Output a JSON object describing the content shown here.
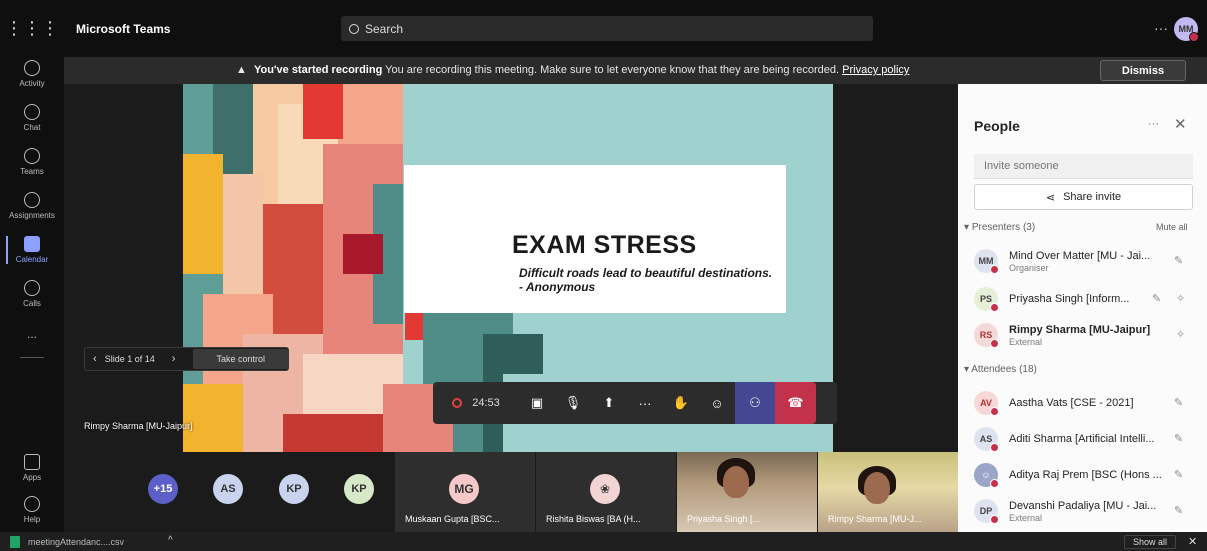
{
  "app": {
    "title": "Microsoft Teams",
    "menu_icon": "grid-icon"
  },
  "search": {
    "placeholder": "Search",
    "label": "Search"
  },
  "user": {
    "initials": "MM"
  },
  "rail": [
    {
      "label": "Activity",
      "icon": "bell-icon"
    },
    {
      "label": "Chat",
      "icon": "chat-icon"
    },
    {
      "label": "Teams",
      "icon": "teams-icon"
    },
    {
      "label": "Assignments",
      "icon": "assignments-icon"
    },
    {
      "label": "Calendar",
      "icon": "calendar-icon",
      "active": true
    },
    {
      "label": "Calls",
      "icon": "phone-icon"
    },
    {
      "label": "...",
      "icon": "more-icon"
    },
    {
      "label": "Apps",
      "icon": "apps-icon"
    },
    {
      "label": "Help",
      "icon": "help-icon"
    }
  ],
  "banner": {
    "bold": "You've started recording",
    "text": "You are recording this meeting. Make sure to let everyone know that they are being recorded.",
    "link": "Privacy policy",
    "dismiss": "Dismiss"
  },
  "slide": {
    "title": "EXAM STRESS",
    "subtitle": "Difficult roads lead to beautiful destinations. - Anonymous",
    "presenter": "Rimpy Sharma [MU-Jaipur]",
    "counter": "Slide 1 of 14",
    "take_control": "Take control"
  },
  "controls": {
    "timer": "24:53"
  },
  "strip": {
    "overflow": "+15",
    "bubbles": [
      {
        "initials": "AS",
        "color": "#c9d3ee"
      },
      {
        "initials": "KP",
        "color": "#c9d3ee"
      },
      {
        "initials": "KP",
        "color": "#d6e8c7"
      }
    ],
    "tiles": [
      {
        "name": "Muskaan Gupta [BSC...",
        "initials": "MG",
        "color": "#f5c9c9"
      },
      {
        "name": "Rishita Biswas [BA (H...",
        "initials": "",
        "color": "#f2d4d4"
      },
      {
        "name": "Priyasha Singh [..."
      },
      {
        "name": "Rimpy Sharma [MU-J..."
      }
    ]
  },
  "people": {
    "title": "People",
    "invite_placeholder": "Invite someone",
    "share_invite": "Share invite",
    "presenters_label": "Presenters (3)",
    "mute_all": "Mute all",
    "attendees_label": "Attendees (18)",
    "presenters": [
      {
        "initials": "MM",
        "name": "Mind Over Matter [MU - Jai...",
        "role": "Organiser",
        "color": "#dfe3f0"
      },
      {
        "initials": "PS",
        "name": "Priyasha Singh [Inform...",
        "role": "",
        "color": "#e6efd8"
      },
      {
        "initials": "RS",
        "name": "Rimpy Sharma [MU-Jaipur]",
        "role": "External",
        "color": "#f5d9d9"
      }
    ],
    "attendees": [
      {
        "initials": "AV",
        "name": "Aastha Vats [CSE - 2021]",
        "role": "",
        "color": "#f8d7d7"
      },
      {
        "initials": "AS",
        "name": "Aditi Sharma [Artificial Intelli...",
        "role": "",
        "color": "#dfe3f0"
      },
      {
        "initials": "",
        "name": "Aditya Raj Prem [BSC (Hons ...",
        "role": "",
        "color": "#9aa5c7"
      },
      {
        "initials": "DP",
        "name": "Devanshi Padaliya [MU - Jai...",
        "role": "External",
        "color": "#dfe3f0"
      }
    ]
  },
  "downloads": {
    "file": "meetingAttendanc....csv",
    "show_all": "Show all"
  },
  "colors": {
    "accent": "#444791",
    "hangup": "#c4314b",
    "slide_bg": "#9fd1cf"
  }
}
